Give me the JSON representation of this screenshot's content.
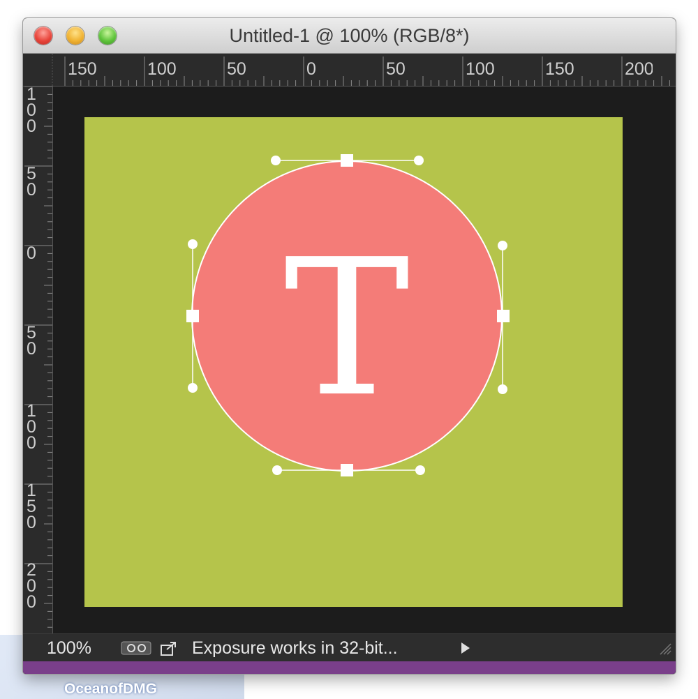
{
  "window": {
    "title": "Untitled-1 @ 100% (RGB/8*)"
  },
  "rulers": {
    "top": [
      "150",
      "100",
      "50",
      "0",
      "50",
      "100",
      "150",
      "200"
    ],
    "left": [
      [
        "1",
        "0",
        "0"
      ],
      [
        "5",
        "0"
      ],
      [
        "0"
      ],
      [
        "5",
        "0"
      ],
      [
        "1",
        "0",
        "0"
      ],
      [
        "1",
        "5",
        "0"
      ],
      [
        "2",
        "0",
        "0"
      ]
    ]
  },
  "document": {
    "background_color": "#b5c44b",
    "shape_color": "#f47c78",
    "glyph": "T"
  },
  "status": {
    "zoom": "100%",
    "message": "Exposure works in 32-bit..."
  },
  "watermark": {
    "text": "OceanofDMG"
  }
}
